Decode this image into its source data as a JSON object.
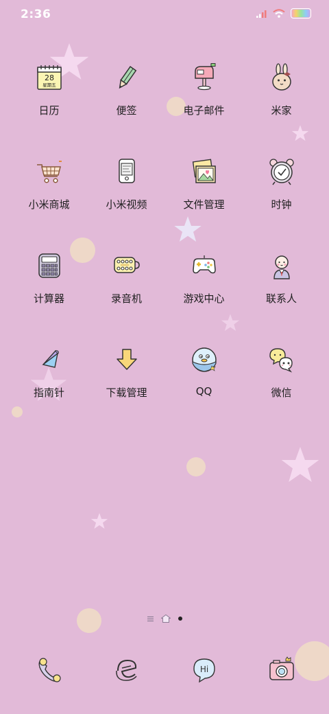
{
  "status": {
    "time": "2:36"
  },
  "apps": [
    {
      "label": "日历",
      "icon": "calendar-icon",
      "date_day": "28",
      "date_weekday": "星期五"
    },
    {
      "label": "便签",
      "icon": "notes-pencil-icon"
    },
    {
      "label": "电子邮件",
      "icon": "mailbox-icon"
    },
    {
      "label": "米家",
      "icon": "mijia-bunny-icon"
    },
    {
      "label": "小米商城",
      "icon": "shopping-cart-icon"
    },
    {
      "label": "小米视频",
      "icon": "video-player-icon"
    },
    {
      "label": "文件管理",
      "icon": "file-photos-icon"
    },
    {
      "label": "时钟",
      "icon": "alarm-clock-icon"
    },
    {
      "label": "计算器",
      "icon": "calculator-icon"
    },
    {
      "label": "录音机",
      "icon": "recorder-icon"
    },
    {
      "label": "游戏中心",
      "icon": "gamepad-icon"
    },
    {
      "label": "联系人",
      "icon": "contacts-person-icon"
    },
    {
      "label": "指南针",
      "icon": "compass-needle-icon"
    },
    {
      "label": "下载管理",
      "icon": "download-arrow-icon"
    },
    {
      "label": "QQ",
      "icon": "qq-penguin-icon"
    },
    {
      "label": "微信",
      "icon": "wechat-bubbles-icon"
    }
  ],
  "page_indicator": {
    "pages": 3,
    "current": 3
  },
  "dock": [
    {
      "icon": "phone-handset-icon"
    },
    {
      "icon": "browser-e-icon"
    },
    {
      "icon": "messaging-hi-icon"
    },
    {
      "icon": "camera-icon"
    }
  ],
  "colors": {
    "wallpaper": "#e2bad8",
    "star": "#f5d9ef",
    "dot": "#f0dcc7"
  }
}
